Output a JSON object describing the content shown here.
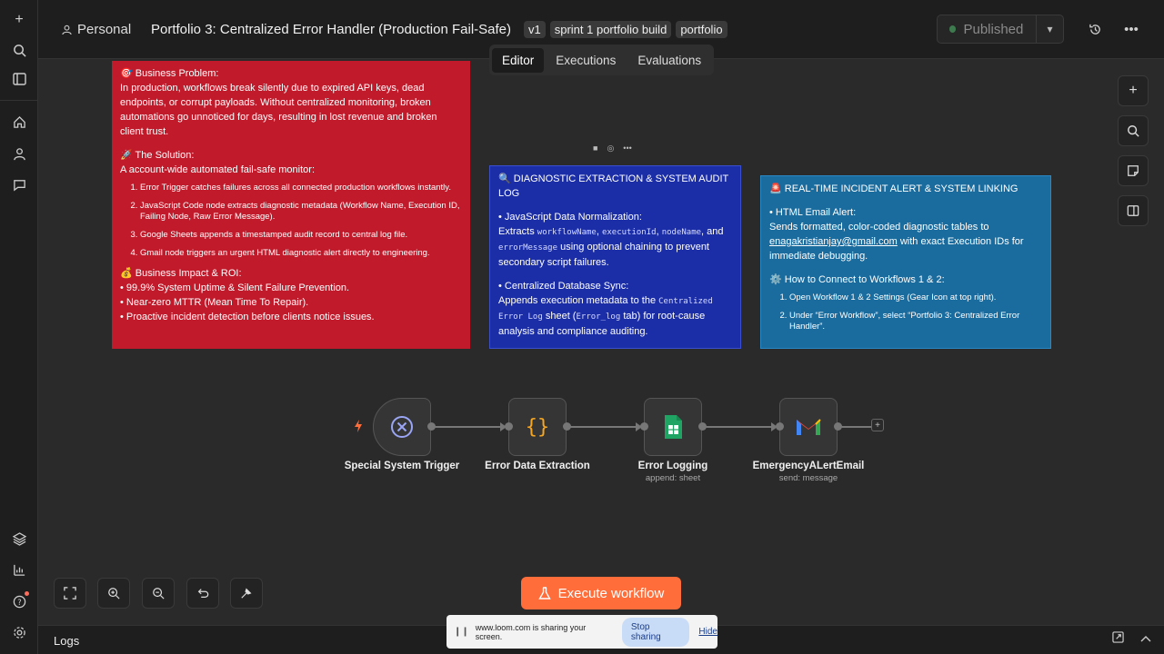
{
  "header": {
    "personal": "Personal",
    "title": "Portfolio 3: Centralized Error Handler (Production Fail-Safe)",
    "tags": [
      "v1",
      "sprint 1 portfolio build",
      "portfolio"
    ],
    "publish_label": "Published"
  },
  "tabs": [
    {
      "label": "Editor",
      "active": true
    },
    {
      "label": "Executions",
      "active": false
    },
    {
      "label": "Evaluations",
      "active": false
    }
  ],
  "notes": {
    "red": {
      "problem_head": "🎯 Business Problem:",
      "problem_body": "In production, workflows break silently due to expired API keys, dead endpoints, or corrupt payloads. Without centralized monitoring, broken automations go unnoticed for days, resulting in lost revenue and broken client trust.",
      "solution_head": "🚀 The Solution:",
      "solution_body": "A account-wide automated fail-safe monitor:",
      "steps": [
        "Error Trigger catches failures across all connected production workflows instantly.",
        "JavaScript Code node extracts diagnostic metadata (Workflow Name, Execution ID, Failing Node, Raw Error Message).",
        "Google Sheets appends a timestamped audit record to central log file.",
        "Gmail node triggers an urgent HTML diagnostic alert directly to engineering."
      ],
      "impact_head": "💰 Business Impact & ROI:",
      "impacts": [
        "• 99.9% System Uptime & Silent Failure Prevention.",
        "• Near-zero MTTR (Mean Time To Repair).",
        "• Proactive incident detection before clients notice issues."
      ]
    },
    "blue": {
      "head": "🔍 DIAGNOSTIC EXTRACTION & SYSTEM AUDIT LOG",
      "norm_head": "• JavaScript Data Normalization:",
      "extracts": "Extracts",
      "f1": "workflowName",
      "f2": "executionId",
      "f3": "nodeName",
      "and": "and",
      "f4": "errorMessage",
      "norm_tail": "using optional chaining to prevent secondary script failures.",
      "sync_head": "• Centralized Database Sync:",
      "sync_pre": "Appends execution metadata to the",
      "sheet_name": "Centralized Error Log",
      "sheet_mid": "sheet (",
      "tab_name": "Error_log",
      "sync_tail": "tab) for root-cause analysis and compliance auditing."
    },
    "teal": {
      "head": "🚨 REAL-TIME INCIDENT ALERT & SYSTEM LINKING",
      "email_head": "• HTML Email Alert:",
      "email_pre": "Sends formatted, color-coded diagnostic tables to",
      "email_addr": "enagakristianjay@gmail.com",
      "email_tail": "with exact Execution IDs for immediate debugging.",
      "connect_head": "⚙️ How to Connect to Workflows 1 & 2:",
      "connect_steps": [
        "Open Workflow 1 & 2 Settings (Gear Icon at top right).",
        "Under “Error Workflow”, select “Portfolio 3: Centralized Error Handler”."
      ]
    }
  },
  "nodes": [
    {
      "label": "Special System Trigger",
      "sub": ""
    },
    {
      "label": "Error Data Extraction",
      "sub": ""
    },
    {
      "label": "Error Logging",
      "sub": "append: sheet"
    },
    {
      "label": "EmergencyALertEmail",
      "sub": "send: message"
    }
  ],
  "execute_label": "Execute workflow",
  "logs_label": "Logs",
  "loom": {
    "message": "www.loom.com is sharing your screen.",
    "stop": "Stop sharing",
    "hide": "Hide"
  },
  "colors": {
    "accent": "#ff6d3a",
    "red_note": "#c11a2b",
    "blue_note": "#1b2ea8",
    "teal_note": "#1a6b9e"
  }
}
